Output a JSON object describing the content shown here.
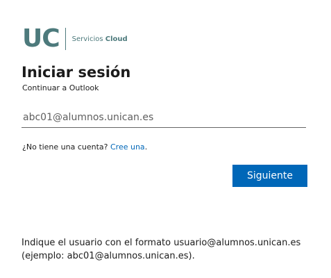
{
  "branding": {
    "logo_text": "UC",
    "service_prefix": "Servicios",
    "service_name": "Cloud",
    "color": "#4d7a7c"
  },
  "signin": {
    "title": "Iniciar sesión",
    "subtitle": "Continuar a Outlook",
    "email_value": "abc01@alumnos.unican.es",
    "no_account_text": "¿No tiene una cuenta?",
    "create_link": "Cree una",
    "create_suffix": ".",
    "next_button": "Siguiente",
    "accent_color": "#0067b8"
  },
  "help": {
    "line1": "Indique el usuario con el formato usuario@alumnos.unican.es",
    "line2": "(ejemplo: abc01@alumnos.unican.es)."
  }
}
